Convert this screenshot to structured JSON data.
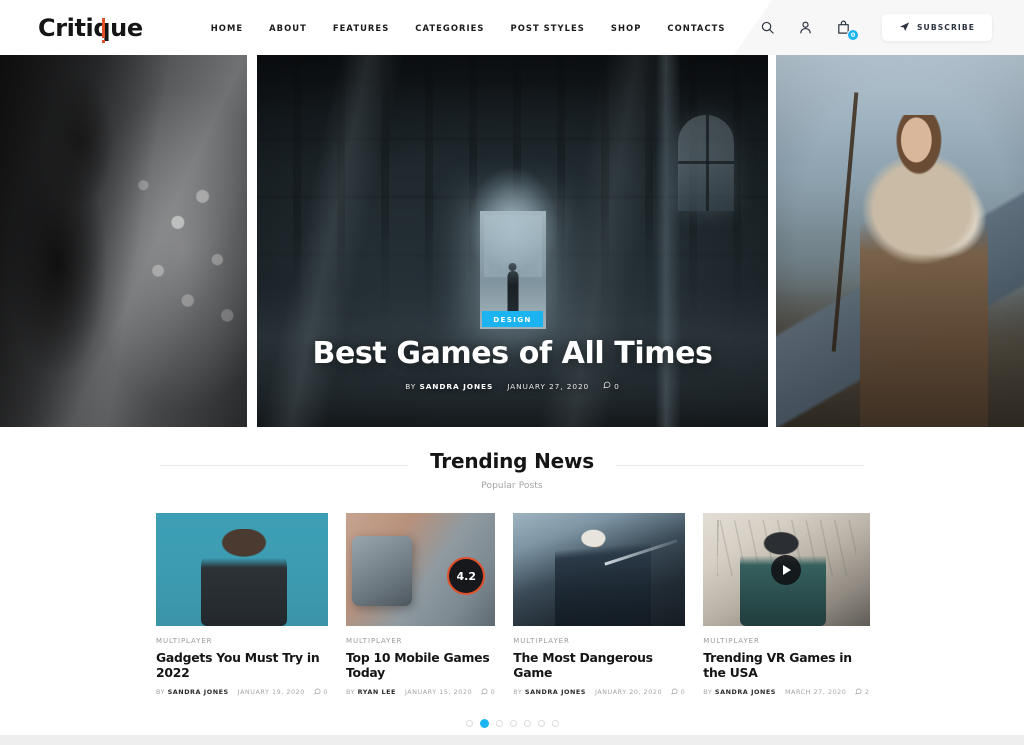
{
  "site": {
    "logo_main": "Criti",
    "logo_q": "q",
    "logo_tail": "ue"
  },
  "header": {
    "nav": [
      {
        "label": "HOME"
      },
      {
        "label": "ABOUT"
      },
      {
        "label": "FEATURES"
      },
      {
        "label": "CATEGORIES"
      },
      {
        "label": "POST STYLES"
      },
      {
        "label": "SHOP"
      },
      {
        "label": "CONTACTS"
      }
    ],
    "icons": {
      "search": "search-icon",
      "account": "user-icon",
      "cart": "shopping-bag-icon"
    },
    "cart_count": "0",
    "subscribe_label": "SUBSCRIBE",
    "accent_blue": "#1cb4f0",
    "accent_orange": "#e2502a"
  },
  "hero": {
    "slides": [
      {
        "alt": "warrior-with-hammer"
      },
      {
        "category": "DESIGN",
        "title": "Best Games of All Times",
        "by": "BY",
        "author": "SANDRA JONES",
        "date": "JANUARY 27, 2020",
        "comments": "0"
      },
      {
        "alt": "woman-in-fur-with-staff"
      }
    ]
  },
  "trending": {
    "title": "Trending News",
    "subtitle": "Popular Posts",
    "cards": [
      {
        "category": "MULTIPLAYER",
        "title": "Gadgets You Must Try in 2022",
        "by": "BY",
        "author": "SANDRA JONES",
        "date": "JANUARY 19, 2020",
        "comments": "0"
      },
      {
        "category": "MULTIPLAYER",
        "title": "Top 10 Mobile Games Today",
        "by": "BY",
        "author": "RYAN LEE",
        "date": "JANUARY 15, 2020",
        "comments": "0",
        "rating": "4.2"
      },
      {
        "category": "MULTIPLAYER",
        "title": "The Most Dangerous Game",
        "by": "BY",
        "author": "SANDRA JONES",
        "date": "JANUARY 20, 2020",
        "comments": "0"
      },
      {
        "category": "MULTIPLAYER",
        "title": "Trending VR Games in the USA",
        "by": "BY",
        "author": "SANDRA JONES",
        "date": "MARCH 27, 2020",
        "comments": "2"
      }
    ],
    "pagination": {
      "total": 7,
      "active_index": 1
    }
  }
}
